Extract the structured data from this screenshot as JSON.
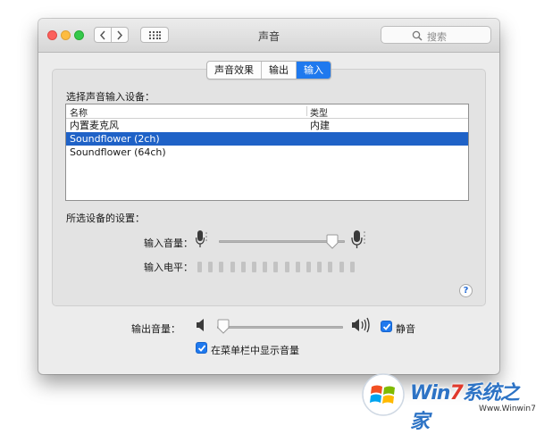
{
  "window": {
    "title": "声音"
  },
  "search": {
    "placeholder": "搜索"
  },
  "tabs": [
    {
      "label": "声音效果",
      "active": false
    },
    {
      "label": "输出",
      "active": false
    },
    {
      "label": "输入",
      "active": true
    }
  ],
  "input": {
    "select_label": "选择声音输入设备：",
    "columns": [
      "名称",
      "类型"
    ],
    "devices": [
      {
        "name": "内置麦克风",
        "type": "内建",
        "selected": false
      },
      {
        "name": "Soundflower (2ch)",
        "type": "",
        "selected": true
      },
      {
        "name": "Soundflower (64ch)",
        "type": "",
        "selected": false
      }
    ],
    "settings_label": "所选设备的设置：",
    "volume_label": "输入音量：",
    "volume_level": 0.9,
    "level_label": "输入电平：",
    "level_bar_count": 15,
    "level_active": 0
  },
  "output": {
    "volume_label": "输出音量：",
    "volume_level": 0.05,
    "mute_label": "静音",
    "mute_checked": true,
    "menubar_label": "在菜单栏中显示音量",
    "menubar_checked": true
  },
  "watermark": {
    "brand_prefix": "Win",
    "brand_digit": "7",
    "brand_suffix": "系统之家",
    "site": "Www.Winwin7.com"
  },
  "colors": {
    "accent": "#1f79ee",
    "selection": "#1f62c7",
    "close": "#fc605c",
    "minimize": "#fdbc40",
    "zoom": "#34c84a"
  }
}
